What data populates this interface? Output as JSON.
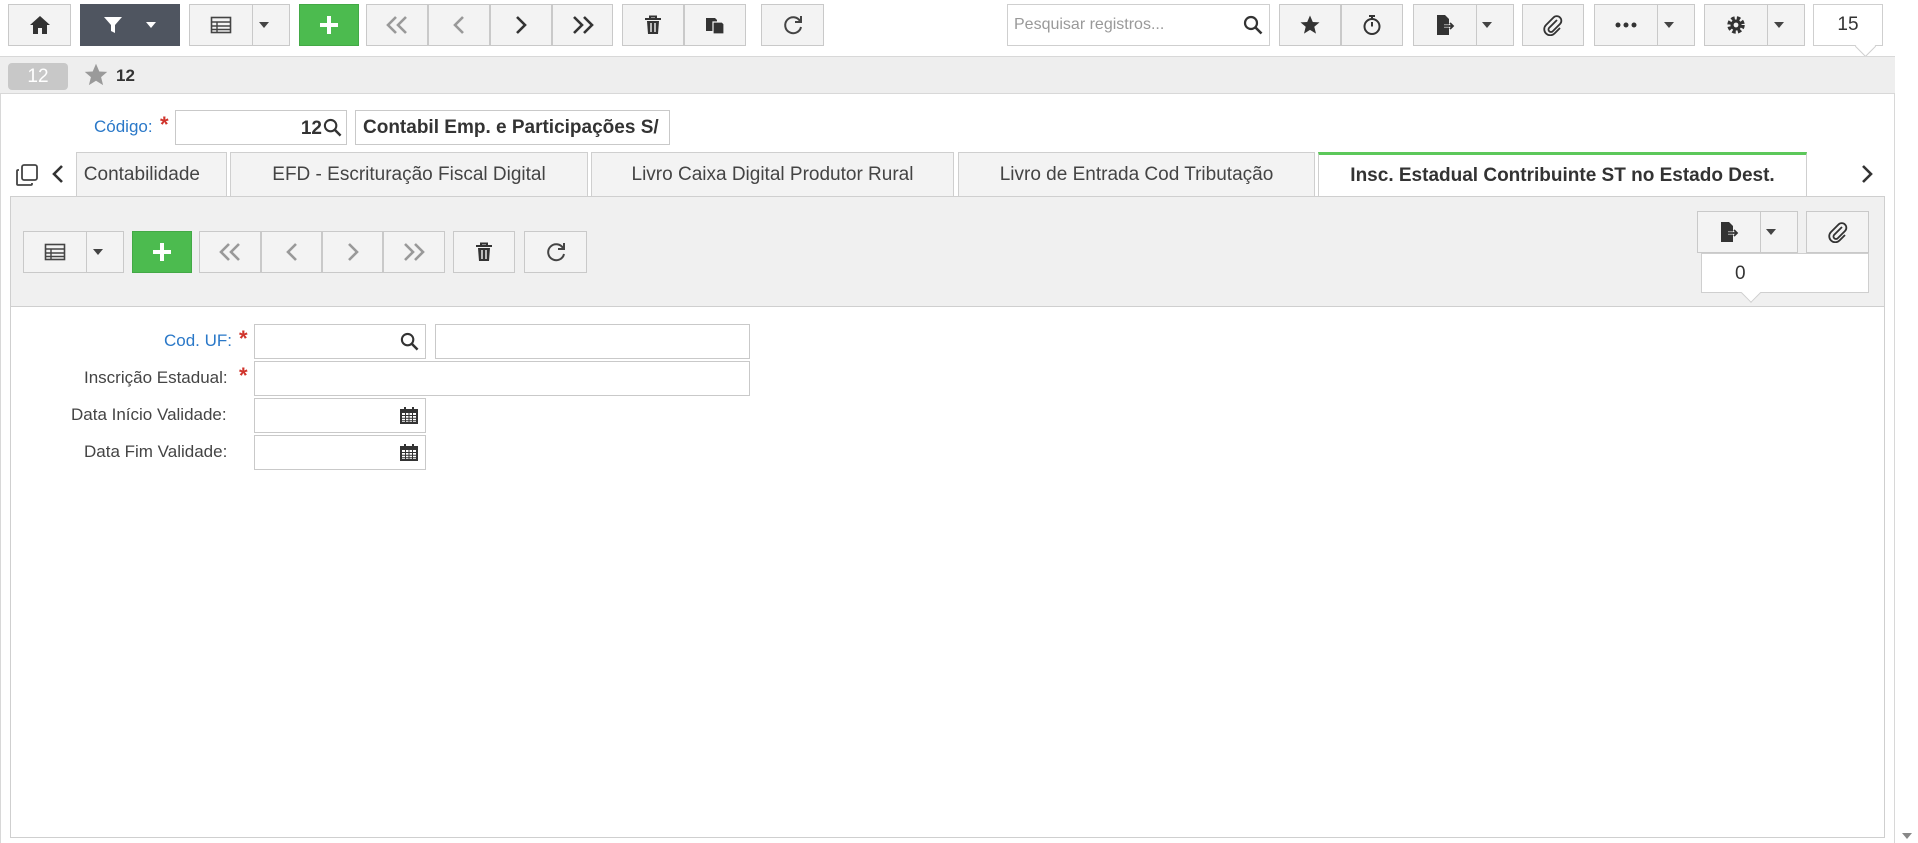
{
  "toolbar": {
    "search_placeholder": "Pesquisar registros...",
    "record_counter": "15"
  },
  "record": {
    "number_badge": "12",
    "title": "12"
  },
  "form": {
    "codigo_label": "Código:",
    "codigo_value": "12",
    "codigo_description": "Contabil Emp. e Participações S/"
  },
  "tabs": [
    {
      "label": "Contabilidade"
    },
    {
      "label": "EFD - Escrituração Fiscal Digital"
    },
    {
      "label": "Livro Caixa Digital Produtor Rural"
    },
    {
      "label": "Livro de Entrada Cod Tributação"
    },
    {
      "label": "Insc. Estadual Contribuinte ST no Estado Dest."
    }
  ],
  "sub_toolbar": {
    "attachment_counter": "0"
  },
  "detail_form": {
    "cod_uf_label": "Cod. UF:",
    "inscricao_label": "Inscrição Estadual:",
    "data_inicio_label": "Data Início Validade:",
    "data_fim_label": "Data Fim Validade:"
  },
  "colors": {
    "accent_green": "#4cbb4f",
    "filter_dark": "#4f5560",
    "link_blue": "#2a78c8",
    "required_red": "#d0342c",
    "active_tab_border": "#5cc85a"
  }
}
